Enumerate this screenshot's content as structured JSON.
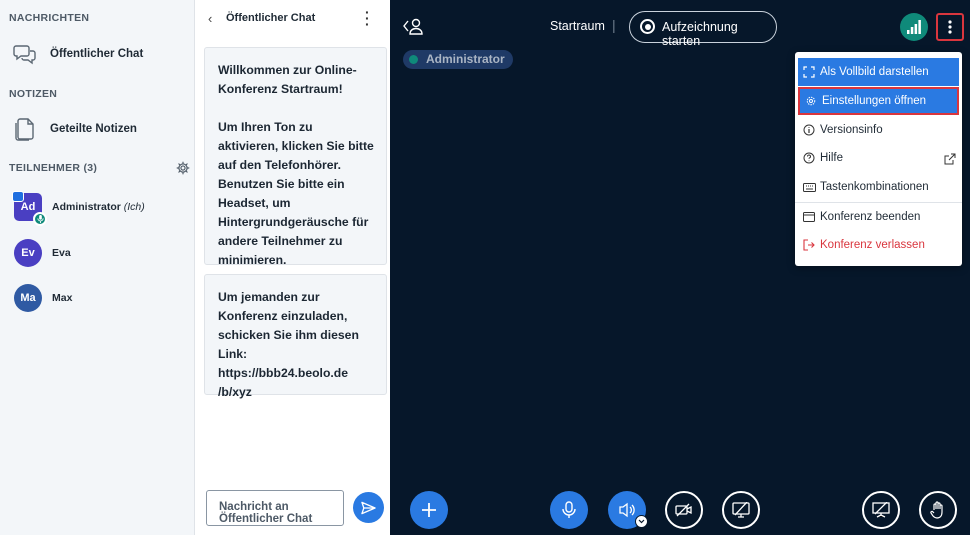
{
  "sidebar": {
    "messages_title": "NACHRICHTEN",
    "public_chat_label": "Öffentlicher Chat",
    "notes_title": "NOTIZEN",
    "shared_notes_label": "Geteilte Notizen",
    "users_title": "TEILNEHMER (3)",
    "users": [
      {
        "initials": "Ad",
        "name": "Administrator",
        "suffix": "(Ich)",
        "color": "#4a3fc2"
      },
      {
        "initials": "Ev",
        "name": "Eva",
        "suffix": "",
        "color": "#4a3fc2"
      },
      {
        "initials": "Ma",
        "name": "Max",
        "suffix": "",
        "color": "#2f5aa3"
      }
    ]
  },
  "chat": {
    "title": "Öffentlicher Chat",
    "welcome_prefix": "Willkommen zur Online-Konferenz ",
    "welcome_room": "Startraum",
    "welcome_suffix": "!",
    "welcome_audio": "Um Ihren Ton zu aktivieren, klicken Sie bitte auf den Telefonhörer. Benutzen Sie bitte ein Headset, um Hintergrundgeräusche für andere Teilnehmer zu minimieren.",
    "invite": "Um jemanden zur Konferenz einzuladen, schicken Sie ihm diesen Link:",
    "invite_link_1": "https://bbb24.beolo.de",
    "invite_link_2": "/b/xyz",
    "input_placeholder": "Nachricht an Öffentlicher Chat"
  },
  "stage": {
    "room_name": "Startraum",
    "separator": "|",
    "record_label": "Aufzeichnung starten",
    "talking_user": "Administrator"
  },
  "menu": {
    "items": [
      {
        "label": "Als Vollbild darstellen",
        "icon": "fullscreen-icon"
      },
      {
        "label": "Einstellungen öffnen",
        "icon": "settings-icon"
      },
      {
        "label": "Versionsinfo",
        "icon": "info-icon"
      },
      {
        "label": "Hilfe",
        "icon": "help-icon"
      },
      {
        "label": "Tastenkombinationen",
        "icon": "keyboard-icon"
      },
      {
        "label": "Konferenz beenden",
        "icon": "end-conference-icon"
      },
      {
        "label": "Konferenz verlassen",
        "icon": "logout-icon"
      }
    ]
  },
  "colors": {
    "accent": "#2a7ae2",
    "stage_bg": "#06172a",
    "danger": "#d9363e",
    "talking": "#0f8a7a"
  }
}
